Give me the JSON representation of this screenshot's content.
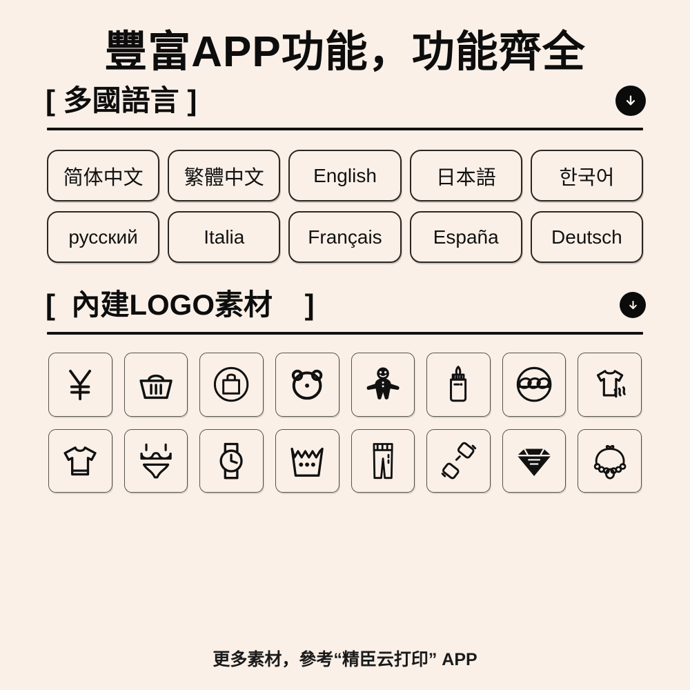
{
  "page": {
    "title": "豐富APP功能，功能齊全",
    "background_color": "#faf0e8",
    "ink_color": "#111111"
  },
  "sections": [
    {
      "id": "languages",
      "title": "[ 多國語言 ]",
      "download_icon": "download-arrow-icon"
    },
    {
      "id": "logo-assets",
      "title": "[  內建LOGO素材    ]",
      "download_icon": "download-arrow-icon"
    }
  ],
  "languages": [
    {
      "label": "简体中文",
      "cjk": true
    },
    {
      "label": "繁體中文",
      "cjk": true
    },
    {
      "label": "English",
      "cjk": false
    },
    {
      "label": "日本語",
      "cjk": true
    },
    {
      "label": "한국어",
      "cjk": true
    },
    {
      "label": "русский",
      "cjk": false
    },
    {
      "label": "Italia",
      "cjk": false
    },
    {
      "label": "Français",
      "cjk": false
    },
    {
      "label": "España",
      "cjk": false
    },
    {
      "label": "Deutsch",
      "cjk": false
    }
  ],
  "logo_icons": [
    {
      "name": "yen-currency-icon"
    },
    {
      "name": "shopping-basket-icon"
    },
    {
      "name": "shopping-bag-circle-icon"
    },
    {
      "name": "bear-face-icon"
    },
    {
      "name": "gingerbread-man-icon"
    },
    {
      "name": "baby-bottle-icon"
    },
    {
      "name": "braided-bread-circle-icon"
    },
    {
      "name": "tshirt-breathable-icon"
    },
    {
      "name": "tshirt-icon"
    },
    {
      "name": "bikini-underwear-icon"
    },
    {
      "name": "wristwatch-icon"
    },
    {
      "name": "wash-basin-icon"
    },
    {
      "name": "jeans-icon"
    },
    {
      "name": "belt-buckle-icon"
    },
    {
      "name": "diamond-icon"
    },
    {
      "name": "necklace-icon"
    }
  ],
  "footer": {
    "note": "更多素材，參考“精臣云打印” APP"
  }
}
